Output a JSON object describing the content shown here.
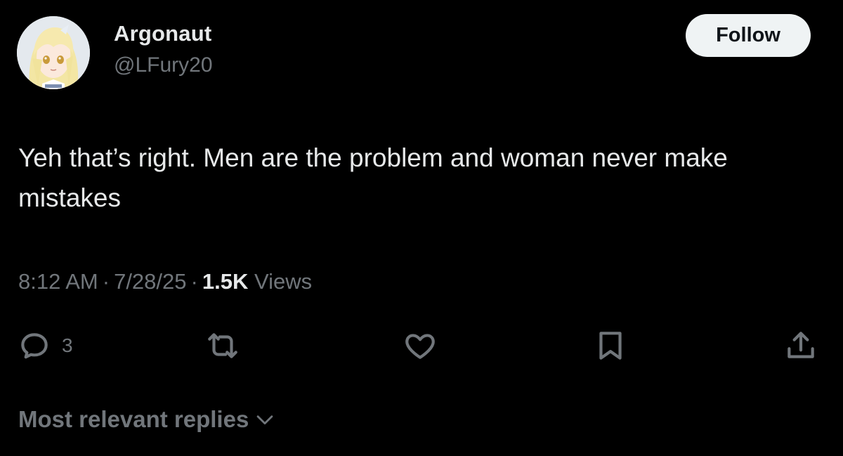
{
  "author": {
    "display_name": "Argonaut",
    "handle": "@LFury20",
    "avatar_icon": "anime-avatar"
  },
  "header": {
    "follow_label": "Follow"
  },
  "tweet": {
    "text": "Yeh that’s right. Men are the problem and woman never make mistakes",
    "time": "8:12 AM",
    "date": "7/28/25",
    "views_count": "1.5K",
    "views_label": "Views",
    "separator": "·"
  },
  "actions": {
    "reply": {
      "icon": "reply-icon",
      "count": "3"
    },
    "repost": {
      "icon": "repost-icon"
    },
    "like": {
      "icon": "heart-icon"
    },
    "bookmark": {
      "icon": "bookmark-icon"
    },
    "share": {
      "icon": "share-icon"
    }
  },
  "replies": {
    "sort_label": "Most relevant replies"
  },
  "colors": {
    "background": "#000000",
    "text_primary": "#e7e9ea",
    "text_secondary": "#71767b",
    "follow_bg": "#eff3f4"
  }
}
